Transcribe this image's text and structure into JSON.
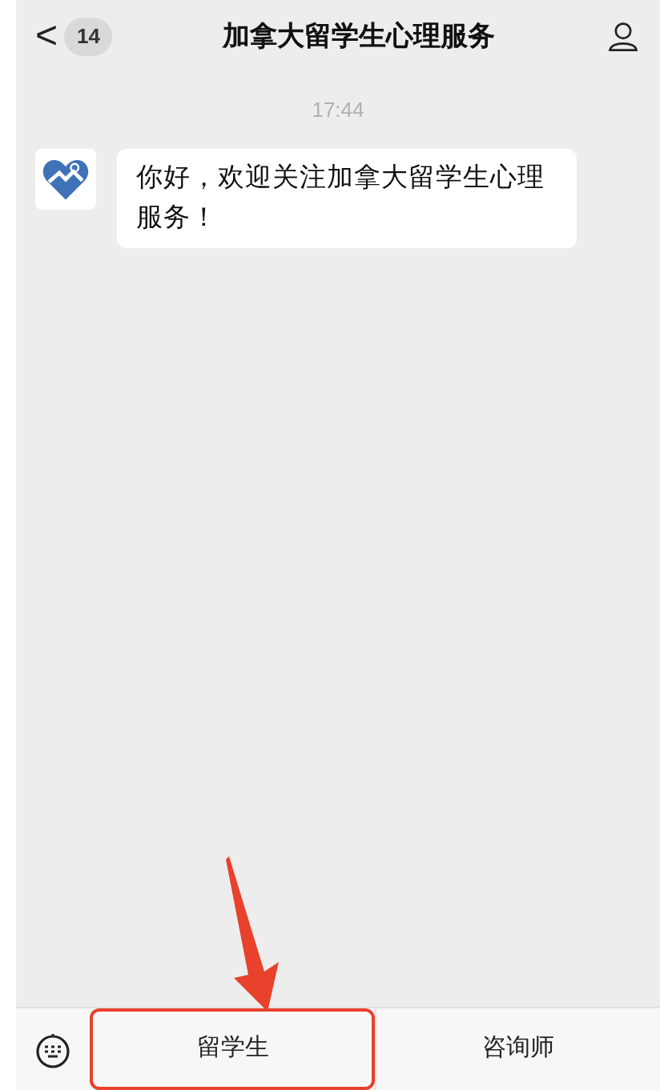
{
  "header": {
    "back_icon": "<",
    "unread_count": "14",
    "title": "加拿大留学生心理服务"
  },
  "messages": [
    {
      "kind": "time",
      "text": "17:44"
    },
    {
      "kind": "incoming",
      "text": "你好，欢迎关注加拿大留学生心理服务！"
    }
  ],
  "menu": [
    {
      "label": "留学生",
      "highlighted": true
    },
    {
      "label": "咨询师",
      "highlighted": false
    }
  ]
}
